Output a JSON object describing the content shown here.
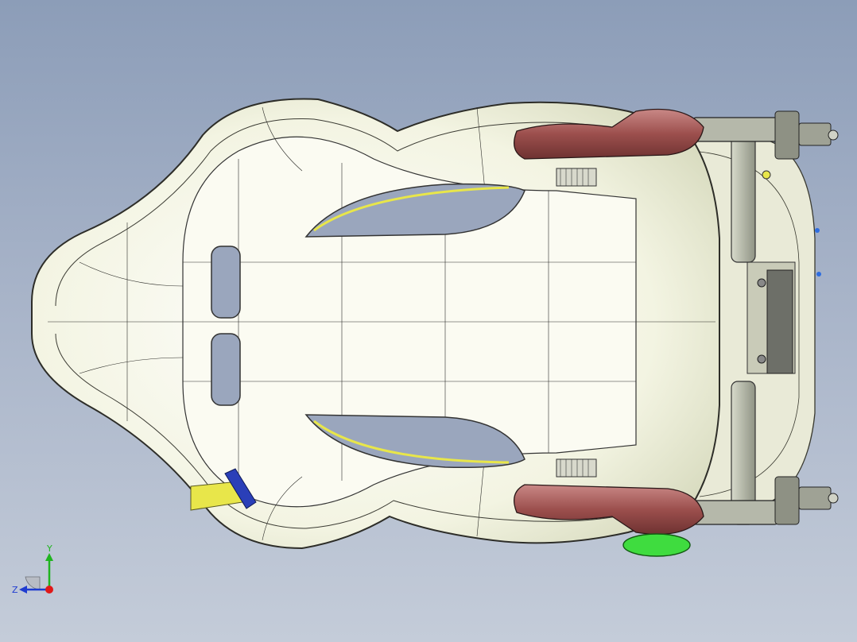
{
  "viewport": {
    "background_top": "#8c9db8",
    "background_bottom": "#c4ccd9"
  },
  "model": {
    "shell_color": "#f2f3dc",
    "bracket_color": "#a65a58",
    "accent_yellow": "#e8e64a",
    "clip_blue": "#2a3fb8",
    "knob_green": "#3fdc3f",
    "frame_gray": "#a9ad9e"
  },
  "triad": {
    "y_label": "Y",
    "z_label": "Z",
    "y_color": "#1fb41f",
    "z_color": "#1f3cd0",
    "x_color": "#e01818"
  }
}
